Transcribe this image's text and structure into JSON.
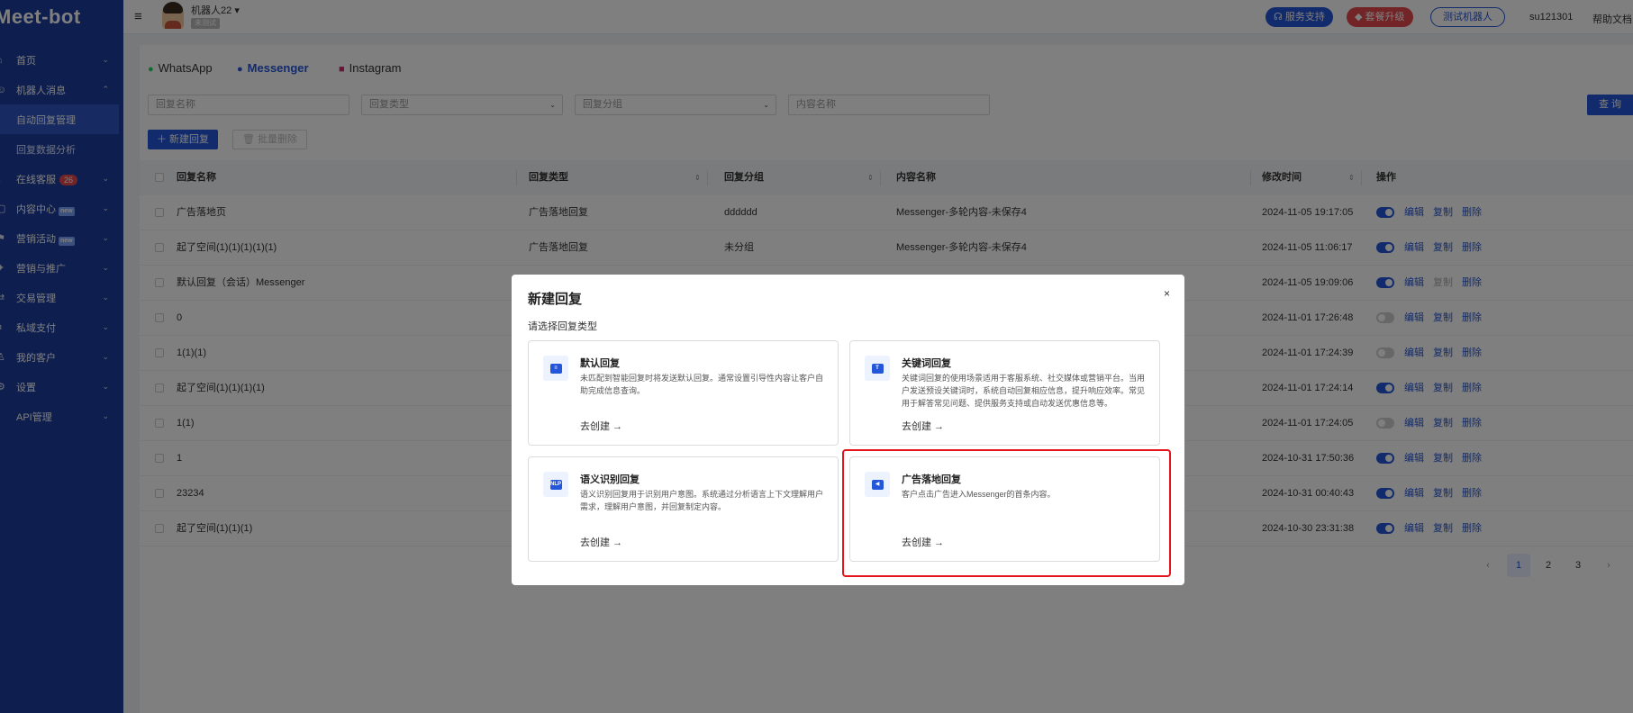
{
  "brand": {
    "logo_text": "Meet-bot"
  },
  "sidebar": {
    "items": [
      {
        "icon": "home-icon",
        "label": "首页",
        "chevron": "⌄"
      },
      {
        "icon": "robot-icon",
        "label": "机器人消息",
        "chevron": "⌃"
      },
      {
        "label": "自动回复管理",
        "active": true
      },
      {
        "label": "回复数据分析"
      },
      {
        "icon": "headset-icon",
        "label": "在线客服",
        "badge": "26",
        "chevron": "⌄"
      },
      {
        "icon": "content-icon",
        "label": "内容中心",
        "tag": "new",
        "chevron": "⌄"
      },
      {
        "icon": "campaign-icon",
        "label": "营销活动",
        "tag": "new",
        "chevron": "⌄"
      },
      {
        "icon": "promotion-icon",
        "label": "营销与推广",
        "chevron": "⌄"
      },
      {
        "icon": "transaction-icon",
        "label": "交易管理",
        "chevron": "⌄"
      },
      {
        "icon": "payment-icon",
        "label": "私域支付",
        "chevron": "⌄"
      },
      {
        "icon": "customer-icon",
        "label": "我的客户",
        "chevron": "⌄"
      },
      {
        "icon": "settings-icon",
        "label": "设置",
        "chevron": "⌄"
      },
      {
        "icon": "api-icon",
        "label": "API管理",
        "chevron": "⌄"
      }
    ]
  },
  "header": {
    "menu_icon": "≡",
    "bot_name": "机器人22",
    "bot_dropdown": "▾",
    "bot_tag": "未测试",
    "support": "服务支持",
    "upgrade": "套餐升级",
    "test_bot": "测试机器人",
    "username": "su121301",
    "help": "帮助文档"
  },
  "tabs": [
    {
      "label": "WhatsApp",
      "icon": "whatsapp-icon",
      "color": "#25d366"
    },
    {
      "label": "Messenger",
      "icon": "messenger-icon",
      "color": "#2456d9",
      "active": true
    },
    {
      "label": "Instagram",
      "icon": "instagram-icon",
      "color": "#d62976"
    }
  ],
  "filters": {
    "name_placeholder": "回复名称",
    "type_placeholder": "回复类型",
    "group_placeholder": "回复分组",
    "content_placeholder": "内容名称",
    "dropdown_arrow": "⌄",
    "search": "查 询"
  },
  "toolbar": {
    "new_reply": "＋ 新建回复",
    "batch_delete": "🗑 批量删除"
  },
  "table": {
    "headers": {
      "name": "回复名称",
      "type": "回复类型",
      "group": "回复分组",
      "content": "内容名称",
      "time": "修改时间",
      "actions": "操作",
      "sort": "⇕"
    },
    "rows": [
      {
        "name": "广告落地页",
        "type": "广告落地回复",
        "group": "dddddd",
        "content": "Messenger-多轮内容-未保存4",
        "time": "2024-11-05 19:17:05",
        "enabled": true,
        "copy_enabled": true
      },
      {
        "name": "起了空间(1)(1)(1)(1)(1)",
        "type": "广告落地回复",
        "group": "未分组",
        "content": "Messenger-多轮内容-未保存4",
        "time": "2024-11-05 11:06:17",
        "enabled": true,
        "copy_enabled": true
      },
      {
        "name": "默认回复（会话）Messenger",
        "type": "",
        "group": "",
        "content": "",
        "time": "2024-11-05 19:09:06",
        "enabled": true,
        "copy_enabled": false
      },
      {
        "name": "0",
        "type": "",
        "group": "",
        "content": "",
        "time": "2024-11-01 17:26:48",
        "enabled": false,
        "copy_enabled": true
      },
      {
        "name": "1(1)(1)",
        "type": "",
        "group": "",
        "content": "",
        "time": "2024-11-01 17:24:39",
        "enabled": false,
        "copy_enabled": true
      },
      {
        "name": "起了空间(1)(1)(1)(1)",
        "type": "",
        "group": "",
        "content": "",
        "time": "2024-11-01 17:24:14",
        "enabled": true,
        "copy_enabled": true
      },
      {
        "name": "1(1)",
        "type": "",
        "group": "",
        "content": "",
        "time": "2024-11-01 17:24:05",
        "enabled": false,
        "copy_enabled": true
      },
      {
        "name": "1",
        "type": "",
        "group": "",
        "content": "",
        "time": "2024-10-31 17:50:36",
        "enabled": true,
        "copy_enabled": true
      },
      {
        "name": "23234",
        "type": "",
        "group": "",
        "content": "",
        "time": "2024-10-31 00:40:43",
        "enabled": true,
        "copy_enabled": true
      },
      {
        "name": "起了空间(1)(1)(1)",
        "type": "",
        "group": "",
        "content": "",
        "time": "2024-10-30 23:31:38",
        "enabled": true,
        "copy_enabled": true
      }
    ],
    "actions": {
      "edit": "编辑",
      "copy": "复制",
      "delete": "删除"
    }
  },
  "pagination": {
    "prev": "‹",
    "pages": [
      "1",
      "2",
      "3"
    ],
    "current": "1",
    "next": "›"
  },
  "modal": {
    "title": "新建回复",
    "close": "×",
    "subtitle": "请选择回复类型",
    "cards": [
      {
        "key": "default",
        "icon": "chat-icon",
        "glyph": "≡",
        "title": "默认回复",
        "desc": "未匹配到智能回复时将发送默认回复。通常设置引导性内容让客户自助完成信息查询。",
        "link": "去创建 →"
      },
      {
        "key": "keyword",
        "icon": "keyword-icon",
        "glyph": "T",
        "title": "关键词回复",
        "desc": "关键词回复的使用场景适用于客服系统、社交媒体或营销平台。当用户发送预设关键词时，系统自动回复相应信息，提升响应效率。常见用于解答常见问题、提供服务支持或自动发送优惠信息等。",
        "link": "去创建 →"
      },
      {
        "key": "nlp",
        "icon": "nlp-icon",
        "glyph": "NLP",
        "title": "语义识别回复",
        "desc": "语义识别回复用于识别用户意图。系统通过分析语言上下文理解用户需求，理解用户意图，并回复制定内容。",
        "link": "去创建 →"
      },
      {
        "key": "ad",
        "icon": "megaphone-icon",
        "glyph": "◀",
        "title": "广告落地回复",
        "desc": "客户点击广告进入Messenger的首条内容。",
        "link": "去创建 →"
      }
    ]
  },
  "colors": {
    "primary": "#2456d9",
    "sidebar": "#1d3e9e",
    "danger": "#e5484d",
    "highlight": "#e5141a"
  }
}
